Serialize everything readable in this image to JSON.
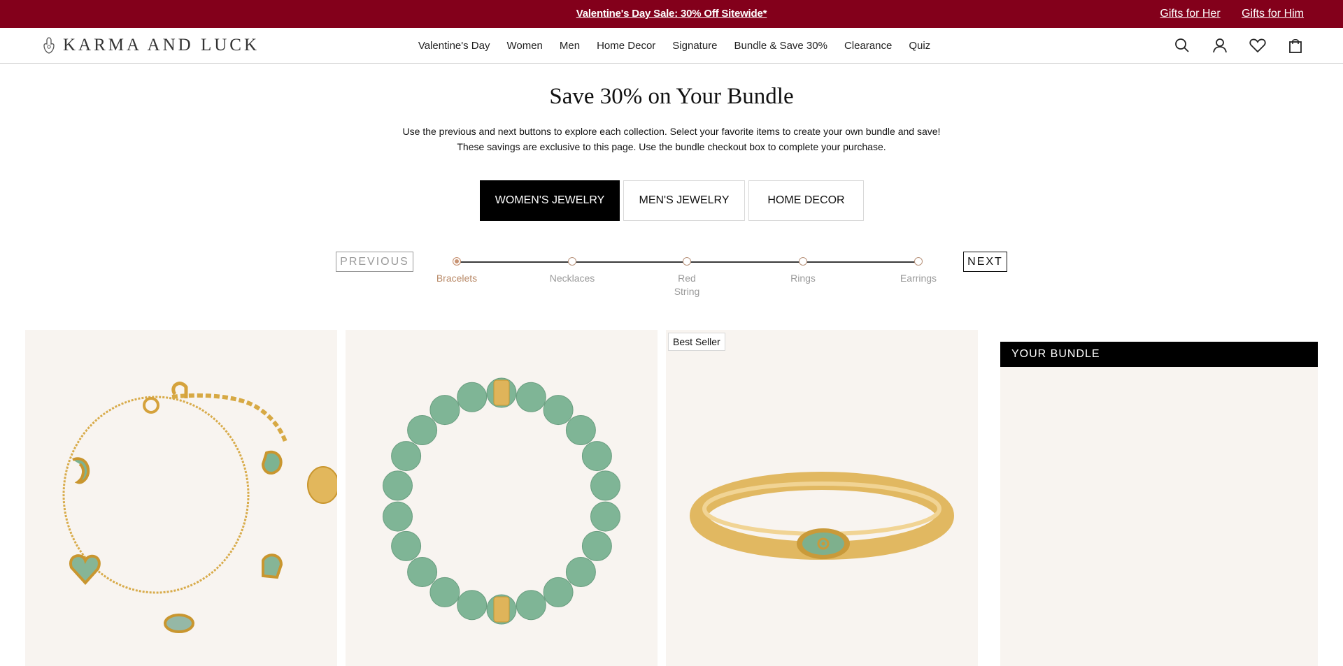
{
  "announcement": {
    "promo": "Valentine's Day Sale: 30% Off Sitewide*",
    "links": [
      "Gifts for Her",
      "Gifts for Him"
    ]
  },
  "header": {
    "logo_text": "KARMA AND LUCK",
    "nav": [
      "Valentine's Day",
      "Women",
      "Men",
      "Home Decor",
      "Signature",
      "Bundle & Save 30%",
      "Clearance",
      "Quiz"
    ],
    "icons": [
      "search-icon",
      "account-icon",
      "heart-icon",
      "bag-icon"
    ]
  },
  "page": {
    "title": "Save 30% on Your Bundle",
    "subtitle_line1": "Use the previous and next buttons to explore each collection. Select your favorite items to create your own bundle and save!",
    "subtitle_line2": "These savings are exclusive to this page. Use the bundle checkout box to complete your purchase."
  },
  "tabs": [
    {
      "label": "WOMEN'S JEWELRY",
      "active": true
    },
    {
      "label": "MEN'S JEWELRY",
      "active": false
    },
    {
      "label": "HOME DECOR",
      "active": false
    }
  ],
  "stepper": {
    "previous_label": "PREVIOUS",
    "next_label": "NEXT",
    "steps": [
      {
        "label": "Bracelets",
        "active": true
      },
      {
        "label": "Necklaces",
        "active": false
      },
      {
        "label": "Red String",
        "active": false
      },
      {
        "label": "Rings",
        "active": false
      },
      {
        "label": "Earrings",
        "active": false
      }
    ]
  },
  "products": [
    {
      "image": "gold-charm-bracelet"
    },
    {
      "image": "green-bead-bracelet"
    },
    {
      "image": "gold-evil-eye-bangle",
      "badge": "Best Seller"
    }
  ],
  "bundle": {
    "title": "YOUR BUNDLE"
  },
  "colors": {
    "announcement_bg": "#83001b",
    "accent_bronze": "#b98a68",
    "card_bg": "#f8f4f0"
  }
}
